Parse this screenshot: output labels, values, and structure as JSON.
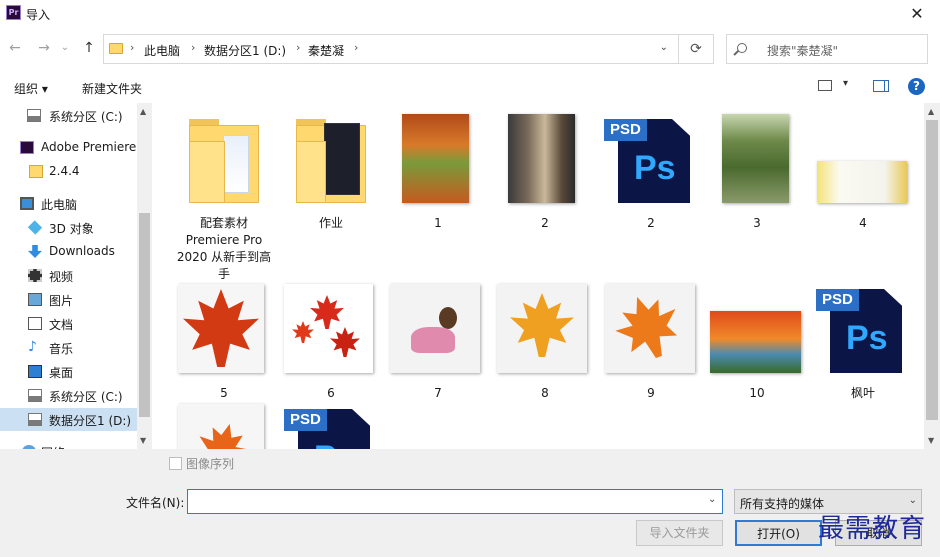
{
  "window": {
    "title": "导入",
    "app_icon": "Pr",
    "close_symbol": "✕"
  },
  "nav": {
    "back": "←",
    "forward": "→",
    "history": "⌄",
    "up": "↑",
    "breadcrumb": [
      "此电脑",
      "数据分区1 (D:)",
      "秦楚凝"
    ],
    "crumb_separator": "›",
    "dropdown": "⌄",
    "refresh": "⟳",
    "search_placeholder": "搜索\"秦楚凝\""
  },
  "toolbar": {
    "organize": "组织 ▾",
    "new_folder": "新建文件夹",
    "help": "?",
    "view_dropdown": "▾"
  },
  "sidebar": {
    "items": [
      {
        "label": "系统分区 (C:)",
        "icon": "drive-icon"
      },
      {
        "label": "Adobe Premiere",
        "icon": "premiere-icon"
      },
      {
        "label": "2.4.4",
        "icon": "folder-icon"
      },
      {
        "label": "此电脑",
        "icon": "computer-icon"
      },
      {
        "label": "3D 对象",
        "icon": "3d-objects-icon"
      },
      {
        "label": "Downloads",
        "icon": "download-icon"
      },
      {
        "label": "视频",
        "icon": "video-icon"
      },
      {
        "label": "图片",
        "icon": "pictures-icon"
      },
      {
        "label": "文档",
        "icon": "documents-icon"
      },
      {
        "label": "音乐",
        "icon": "music-icon"
      },
      {
        "label": "桌面",
        "icon": "desktop-icon"
      },
      {
        "label": "系统分区 (C:)",
        "icon": "drive-icon"
      },
      {
        "label": "数据分区1 (D:)",
        "icon": "drive-icon",
        "selected": true
      },
      {
        "label": "网络",
        "icon": "network-icon"
      }
    ],
    "scroll_up": "▲",
    "scroll_down": "▼"
  },
  "files": [
    {
      "name": "配套素材 Premiere Pro 2020 从新手到高手",
      "type": "folder"
    },
    {
      "name": "作业",
      "type": "folder"
    },
    {
      "name": "1",
      "type": "image"
    },
    {
      "name": "2",
      "type": "image"
    },
    {
      "name": "2",
      "type": "psd"
    },
    {
      "name": "3",
      "type": "image"
    },
    {
      "name": "4",
      "type": "image"
    },
    {
      "name": "5",
      "type": "image"
    },
    {
      "name": "6",
      "type": "image"
    },
    {
      "name": "7",
      "type": "image"
    },
    {
      "name": "8",
      "type": "image"
    },
    {
      "name": "9",
      "type": "image"
    },
    {
      "name": "10",
      "type": "image"
    },
    {
      "name": "枫叶",
      "type": "psd"
    },
    {
      "name": "",
      "type": "image"
    },
    {
      "name": "",
      "type": "psd"
    }
  ],
  "psd_tag": "PSD",
  "ps_label": "Ps",
  "bottom": {
    "image_sequence_label": "图像序列",
    "filename_label": "文件名(N):",
    "filename_value": "",
    "filter_value": "所有支持的媒体",
    "import_folder_button": "导入文件夹",
    "open_button": "打开(O)",
    "cancel_button": "取消"
  },
  "watermark": "最需教育",
  "colors": {
    "accent": "#2f7ad3",
    "selection": "#cce0f3",
    "folder": "#ffd970",
    "psd_bg": "#0b1646",
    "ps_text": "#31a8ff"
  }
}
